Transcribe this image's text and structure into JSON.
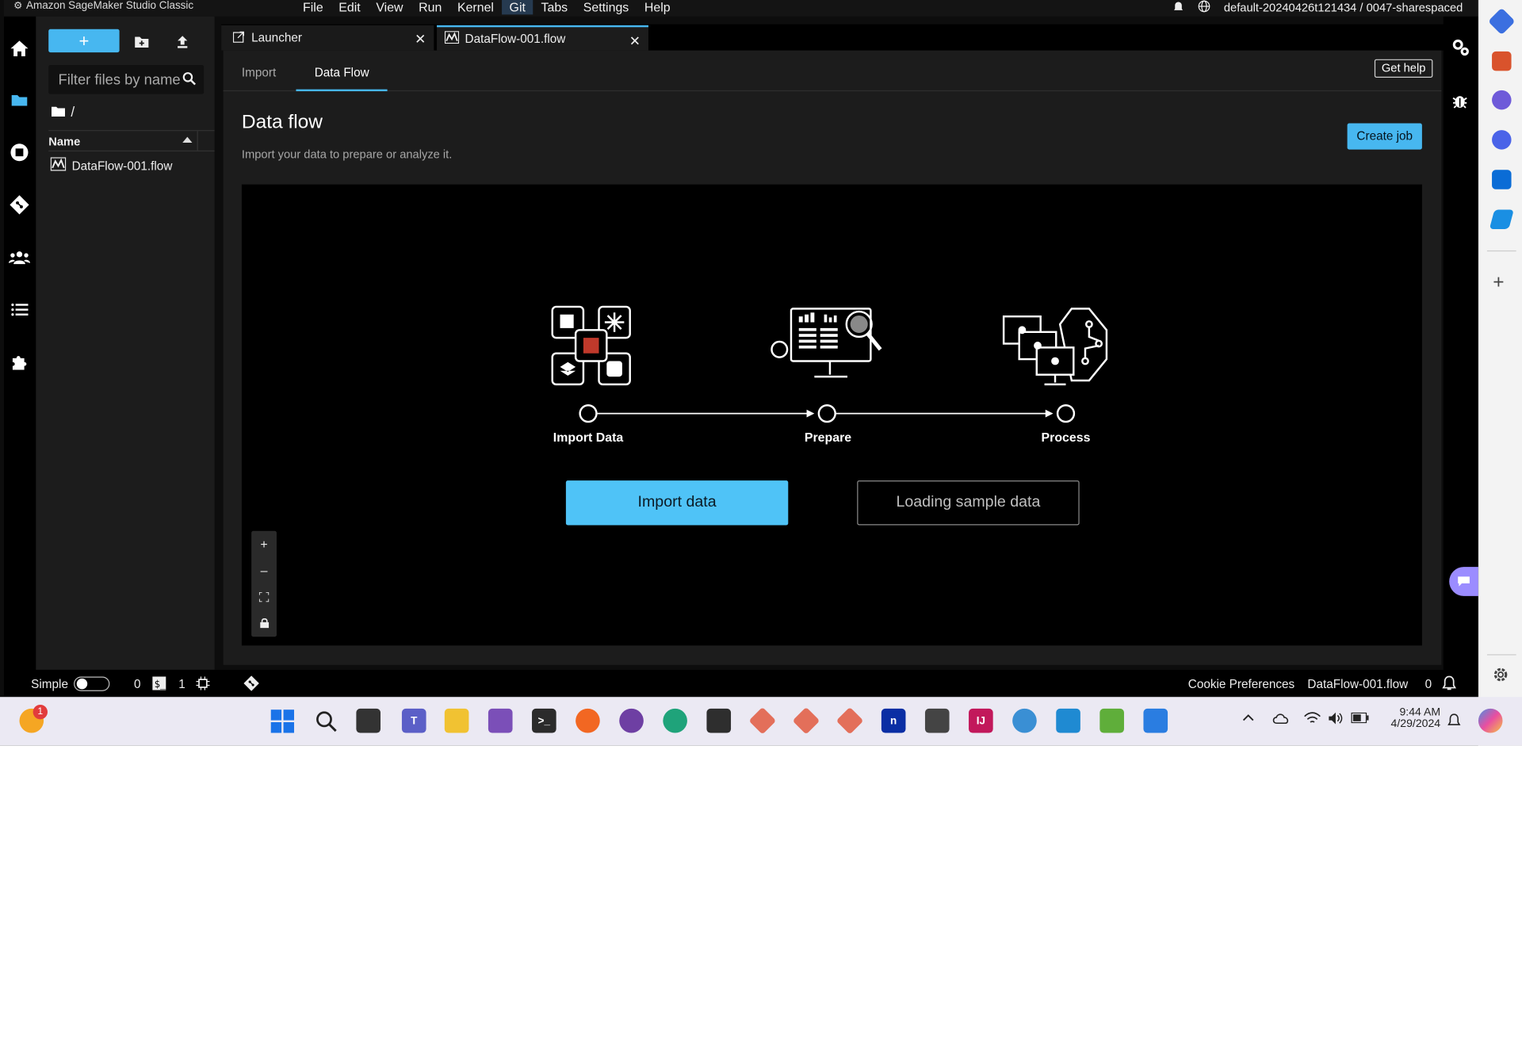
{
  "app_title": "Amazon SageMaker Studio Classic",
  "menu": [
    "File",
    "Edit",
    "View",
    "Run",
    "Kernel",
    "Git",
    "Tabs",
    "Settings",
    "Help"
  ],
  "active_menu": "Git",
  "space": "default-20240426t121434 / 0047-sharespaced",
  "filebrowser": {
    "new_label": "+",
    "filter_placeholder": "Filter files by name",
    "path": "/",
    "column_name": "Name",
    "files": [
      "DataFlow-001.flow"
    ]
  },
  "tabs": [
    {
      "label": "Launcher"
    },
    {
      "label": "DataFlow-001.flow"
    }
  ],
  "subtabs": [
    "Import",
    "Data Flow"
  ],
  "get_help": "Get help",
  "dataflow": {
    "title": "Data flow",
    "subtitle": "Import your data to prepare or analyze it.",
    "create_job": "Create job",
    "steps": [
      "Import Data",
      "Prepare",
      "Process"
    ],
    "import_button": "Import data",
    "sample_button": "Loading sample data"
  },
  "zoom_controls": [
    "+",
    "–",
    "⛶",
    "🔒"
  ],
  "statusbar": {
    "simple": "Simple",
    "count_a": "0",
    "count_b": "1",
    "cookie": "Cookie Preferences",
    "file": "DataFlow-001.flow",
    "notifications": "0"
  },
  "taskbar": {
    "badge": "1",
    "time": "9:44 AM",
    "date": "4/29/2024"
  },
  "colors": {
    "accent": "#47b7f0",
    "background": "#0d0d0d",
    "panel": "#1c1c1c"
  }
}
